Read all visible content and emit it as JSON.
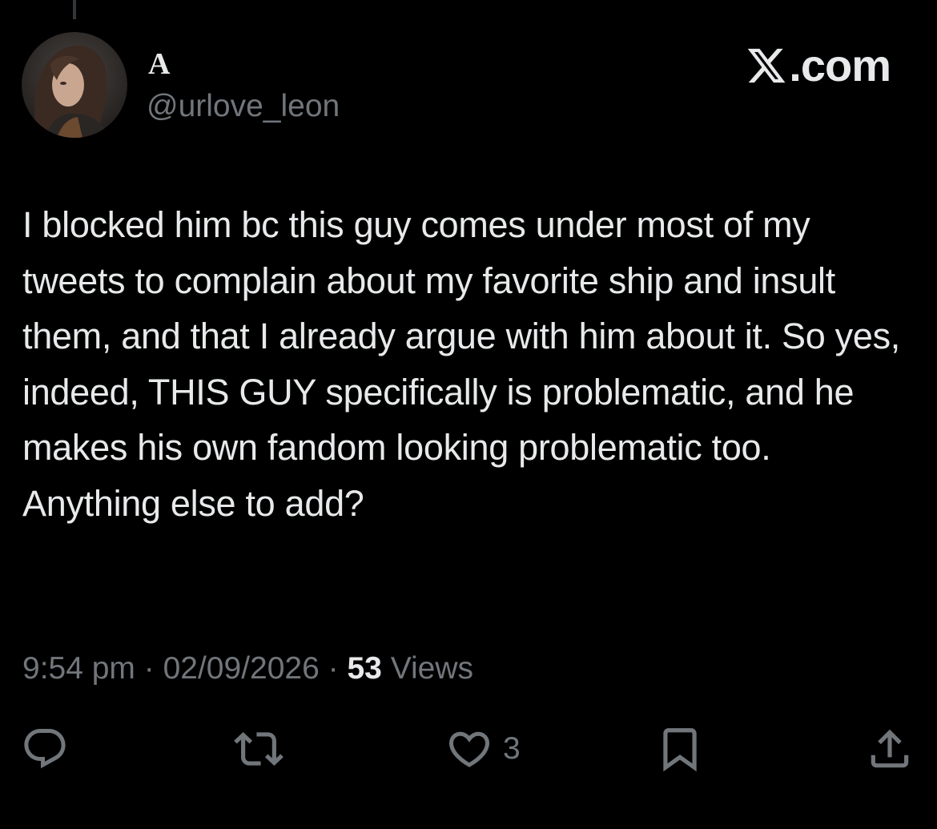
{
  "brand": {
    "text": ".com",
    "icon": "x-logo-icon"
  },
  "author": {
    "display_name": "A",
    "handle": "@urlove_leon",
    "avatar": "avatar-image"
  },
  "tweet": {
    "text": "I blocked him bc this guy comes under most of my tweets to complain about my favorite ship and insult them, and that I already argue with him about it. So yes, indeed, THIS GUY specifically is problematic, and he makes his own fandom looking problematic too. Anything else to add?"
  },
  "meta": {
    "time": "9:54 pm",
    "separator1": " · ",
    "date": "02/09/2026",
    "separator2": " · ",
    "views_count": "53",
    "views_label": " Views"
  },
  "actions": {
    "reply_icon": "reply-icon",
    "retweet_icon": "retweet-icon",
    "like_icon": "heart-icon",
    "like_count": "3",
    "bookmark_icon": "bookmark-icon",
    "share_icon": "share-icon"
  },
  "colors": {
    "background": "#000000",
    "text_primary": "#e7e9ea",
    "text_secondary": "#71767b"
  }
}
